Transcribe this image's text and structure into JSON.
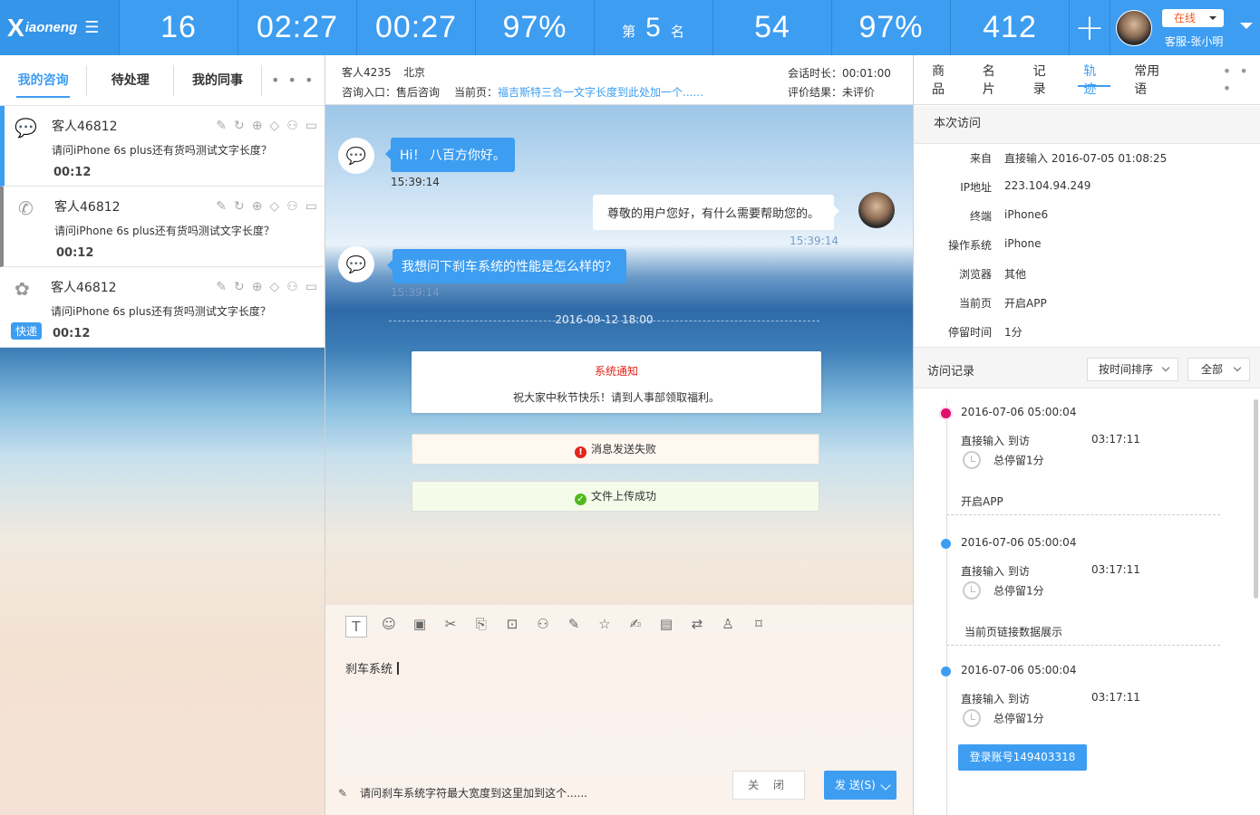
{
  "topbar": {
    "logo_x": "X",
    "logo_text": "iaoneng",
    "stats": [
      "16",
      "02:27",
      "00:27",
      "97%"
    ],
    "rank": {
      "prefix": "第",
      "value": "5",
      "suffix": "名"
    },
    "stats2": [
      "54",
      "97%",
      "412"
    ],
    "plus": "+",
    "status": "在线",
    "username": "客服-张小明"
  },
  "left": {
    "tabs": [
      "我的咨询",
      "待处理",
      "我的同事"
    ],
    "more": "• • •",
    "items": [
      {
        "name": "客人46812",
        "message": "请问iPhone 6s plus还有货吗测试文字长度？",
        "time": "00:12",
        "icon": "wechat-icon"
      },
      {
        "name": "客人46812",
        "message": "请问iPhone 6s plus还有货吗测试文字长度？",
        "time": "00:12",
        "icon": "phone-icon"
      },
      {
        "name": "客人46812",
        "message": "请问iPhone 6s plus还有货吗测试文字长度？",
        "time": "00:12",
        "icon": "paw-icon",
        "badge": "快递"
      }
    ]
  },
  "chat": {
    "guest": "客人4235",
    "city": "北京",
    "entry": "咨询入口：售后咨询",
    "page_label": "当前页：",
    "page_value": "福吉斯特三合一文字长度到此处加一个......",
    "duration": "会话时长：00:01:00",
    "rating": "评价结果：未评价",
    "messages": [
      {
        "text": "Hi！ 八百方你好。",
        "time": "15:39:14"
      },
      {
        "text": "尊敬的用户您好，有什么需要帮助您的。",
        "time": "15:39:14"
      },
      {
        "text": "我想问下刹车系统的性能是怎么样的？",
        "time": "15:39:14"
      }
    ],
    "divider": "2016-09-12 18:00",
    "notice_title": "系统通知",
    "notice_text": "祝大家中秋节快乐！请到人事部领取福利。",
    "fail_text": "消息发送失败",
    "ok_text": "文件上传成功",
    "input_text": "刹车系统",
    "hint": "请问刹车系统字符最大宽度到这里加到这个......",
    "close_label": "关 闭",
    "send_label": "发 送(S)"
  },
  "right": {
    "tabs": [
      "商品",
      "名片",
      "记录",
      "轨迹",
      "常用语"
    ],
    "more": "• • •",
    "visit_title": "本次访问",
    "info": [
      {
        "k": "来自",
        "v": "直接输入 2016-07-05 01:08:25"
      },
      {
        "k": "IP地址",
        "v": "223.104.94.249"
      },
      {
        "k": "终端",
        "v": "iPhone6"
      },
      {
        "k": "操作系统",
        "v": "iPhone"
      },
      {
        "k": "浏览器",
        "v": "其他"
      },
      {
        "k": "当前页",
        "v": "开启APP"
      },
      {
        "k": "停留时间",
        "v": "1分"
      }
    ],
    "records_title": "访问记录",
    "sort_label": "按时间排序",
    "filter_label": "全部",
    "records": [
      {
        "date": "2016-07-06 05:00:04",
        "src": "直接输入 到访",
        "at": "03:17:11",
        "stay": "总停留1分",
        "page": "开启APP"
      },
      {
        "date": "2016-07-06 05:00:04",
        "src": "直接输入 到访",
        "at": "03:17:11",
        "stay": "总停留1分",
        "page": "当前页链接数据展示"
      },
      {
        "date": "2016-07-06 05:00:04",
        "src": "直接输入 到访",
        "at": "03:17:11",
        "stay": "总停留1分"
      }
    ],
    "login_label": "登录账号149403318"
  }
}
